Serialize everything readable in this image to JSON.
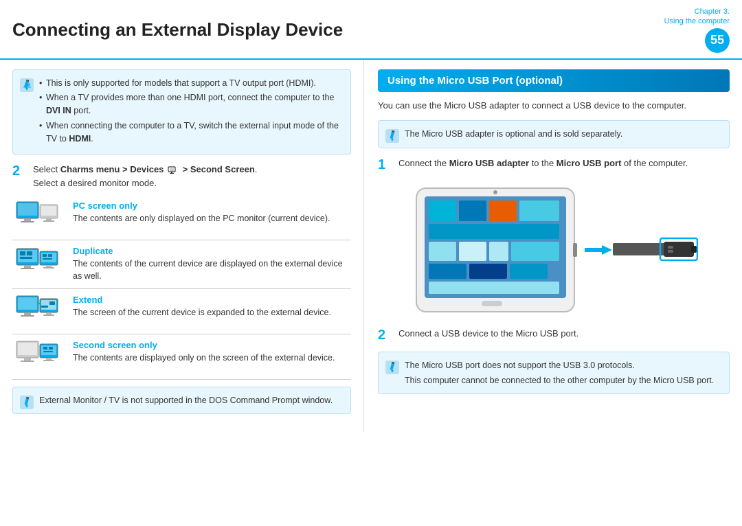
{
  "header": {
    "title": "Connecting an External Display Device",
    "chapter_line1": "Chapter 3.",
    "chapter_line2": "Using the computer",
    "page_number": "55"
  },
  "left": {
    "note1": {
      "bullets": [
        "This is only supported for models that support a TV output port (HDMI).",
        "When a TV provides more than one HDMI port, connect the computer to the ",
        "DVI IN",
        " port.",
        "When connecting the computer to a TV, switch the external input mode of the TV to ",
        "HDMI",
        "."
      ],
      "lines": [
        {
          "text": "This is only supported for models that support a TV output port (HDMI).",
          "bold": false
        },
        {
          "pre": "When a TV provides more than one HDMI port, connect the computer to the ",
          "bold_part": "DVI IN",
          "post": " port.",
          "bold": true
        },
        {
          "pre": "When connecting the computer to a TV, switch the external input mode of the TV to ",
          "bold_part": "HDMI",
          "post": ".",
          "bold": true
        }
      ]
    },
    "step2_pre": "Select ",
    "step2_bold1": "Charms menu > Devices",
    "step2_mid": " ",
    "step2_bold2": "> Second Screen",
    "step2_post": ".",
    "step2_sub": "Select a desired monitor mode.",
    "modes": [
      {
        "label": "PC screen only",
        "desc": "The contents are only displayed on the PC monitor (current device).",
        "icon_type": "pc_only"
      },
      {
        "label": "Duplicate",
        "desc": "The contents of the current device are displayed on the external device as well.",
        "icon_type": "duplicate"
      },
      {
        "label": "Extend",
        "desc": "The screen of the current device is expanded to the external device.",
        "icon_type": "extend"
      },
      {
        "label": "Second screen only",
        "desc": "The contents are displayed only on the screen of the external device.",
        "icon_type": "second_only"
      }
    ],
    "note2": "External Monitor / TV is not supported in the DOS Command Prompt window."
  },
  "right": {
    "section_heading": "Using the Micro USB Port (optional)",
    "intro": "You can use the Micro USB adapter to connect a USB device to the computer.",
    "note1": "The Micro USB adapter is optional and is sold separately.",
    "step1_pre": "Connect the ",
    "step1_bold1": "Micro USB adapter",
    "step1_mid": " to the ",
    "step1_bold2": "Micro USB port",
    "step1_post": " of the computer.",
    "step2": "Connect a USB device to the Micro USB port.",
    "note2_line1": "The Micro USB port does not support the USB 3.0 protocols.",
    "note2_line2": "This computer cannot be connected to the other computer by the Micro USB port."
  },
  "colors": {
    "accent": "#00aeef",
    "dark_accent": "#0077b6",
    "note_bg": "#e8f6fd",
    "note_border": "#b8e0f5",
    "text": "#333333"
  }
}
